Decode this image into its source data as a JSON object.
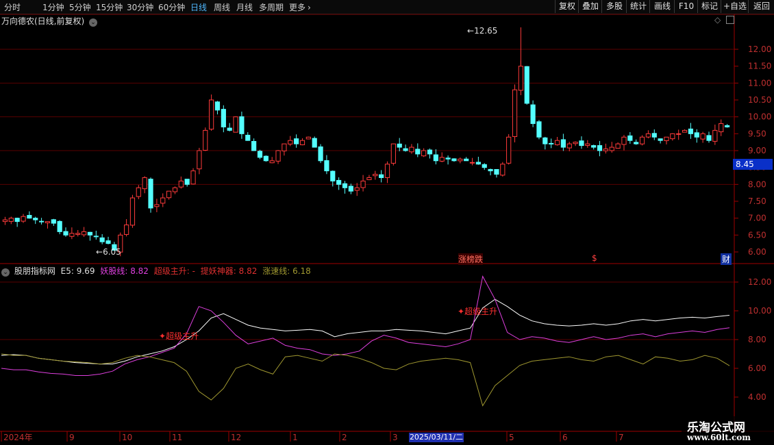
{
  "toolbar": {
    "periods": [
      "分时",
      "1分钟",
      "5分钟",
      "15分钟",
      "30分钟",
      "60分钟",
      "日线",
      "周线",
      "月线",
      "多周期",
      "更多"
    ],
    "active_period": "日线",
    "tools": [
      "复权",
      "叠加",
      "多股",
      "统计",
      "画线",
      "F10",
      "标记",
      "+自选",
      "返回"
    ]
  },
  "stock_title": "万向德农(日线,前复权)",
  "price_chart": {
    "y_ticks": [
      "12.00",
      "11.50",
      "11.00",
      "10.50",
      "10.00",
      "9.50",
      "9.00",
      "8.50",
      "8.00",
      "7.50",
      "7.00",
      "6.50",
      "6.00"
    ],
    "current_price": "8.45",
    "high_label": "12.65",
    "low_label": "6.05",
    "event_labels": [
      {
        "text": "涨榜跌"
      },
      {
        "text": "$"
      },
      {
        "text": "财"
      }
    ]
  },
  "indicator": {
    "name": "股朋指标网",
    "values": [
      {
        "label": "E5:",
        "value": "9.69",
        "color": "#e0e0e0"
      },
      {
        "label": "妖股线:",
        "value": "8.82",
        "color": "#e040e0"
      },
      {
        "label": "超级主升:",
        "value": "-",
        "color": "#e03030"
      },
      {
        "label": "提妖神器:",
        "value": "8.82",
        "color": "#e03030"
      },
      {
        "label": "涨速线:",
        "value": "6.18",
        "color": "#a09830"
      }
    ],
    "y_ticks": [
      "12.00",
      "10.00",
      "8.00",
      "6.00",
      "4.00"
    ],
    "annotation": "超级主升"
  },
  "x_axis": {
    "labels": [
      "2024年",
      "9",
      "10",
      "11",
      "12",
      "1",
      "2",
      "3",
      "5",
      "6",
      "7"
    ],
    "cursor_date": "2025/03/11/二"
  },
  "watermark": {
    "line1": "乐淘公式网",
    "line2": "www.60lt.com"
  },
  "colors": {
    "up": "#ff3b3b",
    "down": "#54ffff",
    "grid": "#5a0000",
    "e5": "#ffffff",
    "yao": "#e040e0",
    "speed": "#a09830"
  },
  "chart_data": [
    {
      "type": "candlestick",
      "title": "万向德农(日线,前复权)",
      "y_range": [
        5.9,
        13.0
      ],
      "y_ticks": [
        6.0,
        6.5,
        7.0,
        7.5,
        8.0,
        8.5,
        9.0,
        9.5,
        10.0,
        10.5,
        11.0,
        11.5,
        12.0
      ],
      "close_series_approx": [
        6.95,
        7.0,
        6.9,
        7.05,
        7.0,
        6.95,
        6.9,
        6.9,
        6.85,
        6.6,
        6.5,
        6.55,
        6.55,
        6.6,
        6.5,
        6.45,
        6.3,
        6.25,
        6.05,
        6.5,
        6.8,
        7.6,
        7.9,
        8.2,
        7.3,
        7.4,
        7.6,
        7.8,
        7.9,
        8.1,
        8.0,
        8.4,
        9.0,
        9.6,
        10.5,
        10.2,
        9.7,
        9.6,
        10.0,
        9.5,
        9.3,
        9.0,
        8.8,
        8.7,
        8.7,
        9.0,
        9.2,
        9.3,
        9.2,
        9.3,
        9.4,
        9.1,
        8.7,
        8.4,
        8.1,
        8.0,
        7.9,
        7.8,
        7.9,
        8.1,
        8.2,
        8.3,
        8.2,
        8.6,
        9.2,
        9.1,
        9.0,
        9.1,
        8.9,
        9.0,
        8.9,
        8.7,
        8.8,
        8.75,
        8.7,
        8.75,
        8.7,
        8.65,
        8.6,
        8.5,
        8.4,
        8.3,
        8.6,
        9.4,
        10.8,
        11.5,
        10.4,
        9.8,
        9.4,
        9.2,
        9.2,
        9.3,
        9.1,
        9.2,
        9.25,
        9.15,
        9.2,
        9.1,
        9.0,
        9.05,
        9.1,
        9.2,
        9.4,
        9.3,
        9.2,
        9.4,
        9.5,
        9.4,
        9.3,
        9.4,
        9.5,
        9.5,
        9.6,
        9.5,
        9.4,
        9.5,
        9.3,
        9.6,
        9.8,
        9.7
      ],
      "annotations": {
        "high": 12.65,
        "low": 6.05,
        "current": 8.45
      }
    },
    {
      "type": "line",
      "title": "股朋指标网",
      "y_range": [
        3.0,
        13.0
      ],
      "y_ticks": [
        4.0,
        6.0,
        8.0,
        10.0,
        12.0
      ],
      "series": [
        {
          "name": "E5",
          "last": 9.69,
          "values": [
            6.9,
            6.95,
            6.9,
            6.7,
            6.6,
            6.5,
            6.4,
            6.35,
            6.3,
            6.3,
            6.5,
            6.8,
            7.0,
            7.2,
            7.5,
            8.0,
            8.6,
            9.5,
            9.8,
            9.4,
            9.0,
            8.8,
            8.7,
            8.6,
            8.65,
            8.7,
            8.6,
            8.2,
            8.4,
            8.5,
            8.6,
            8.6,
            8.7,
            8.65,
            8.6,
            8.5,
            8.4,
            8.6,
            8.8,
            10.2,
            10.8,
            10.3,
            9.7,
            9.3,
            9.1,
            9.0,
            8.95,
            9.0,
            9.1,
            9.0,
            9.1,
            9.3,
            9.4,
            9.3,
            9.4,
            9.5,
            9.55,
            9.5,
            9.6,
            9.69
          ]
        },
        {
          "name": "妖股线",
          "last": 8.82,
          "values": [
            6.0,
            5.9,
            5.9,
            5.75,
            5.65,
            5.6,
            5.5,
            5.5,
            5.6,
            5.8,
            6.3,
            6.6,
            6.8,
            7.1,
            7.4,
            8.4,
            10.3,
            10.0,
            9.2,
            8.3,
            7.7,
            7.9,
            8.1,
            7.6,
            7.4,
            7.3,
            7.0,
            6.9,
            7.0,
            7.2,
            7.9,
            8.3,
            8.1,
            7.8,
            7.7,
            7.6,
            7.5,
            7.7,
            8.0,
            12.4,
            10.8,
            8.5,
            8.0,
            8.2,
            8.1,
            7.9,
            7.8,
            8.0,
            8.2,
            8.0,
            8.1,
            8.3,
            8.4,
            8.2,
            8.4,
            8.5,
            8.6,
            8.5,
            8.7,
            8.82
          ]
        },
        {
          "name": "涨速线",
          "last": 6.18,
          "values": [
            7.0,
            6.9,
            6.9,
            6.7,
            6.6,
            6.5,
            6.45,
            6.4,
            6.3,
            6.4,
            6.7,
            6.9,
            6.8,
            6.6,
            6.4,
            5.8,
            4.4,
            3.8,
            4.6,
            6.0,
            6.3,
            5.9,
            5.6,
            6.8,
            6.9,
            6.7,
            6.5,
            7.0,
            6.9,
            6.7,
            6.4,
            6.0,
            5.9,
            6.3,
            6.5,
            6.6,
            6.7,
            6.6,
            6.4,
            3.4,
            4.8,
            5.5,
            6.2,
            6.5,
            6.6,
            6.7,
            6.8,
            6.6,
            6.5,
            6.8,
            6.9,
            6.6,
            6.3,
            6.8,
            6.7,
            6.5,
            6.6,
            6.9,
            6.7,
            6.18
          ]
        }
      ]
    }
  ]
}
